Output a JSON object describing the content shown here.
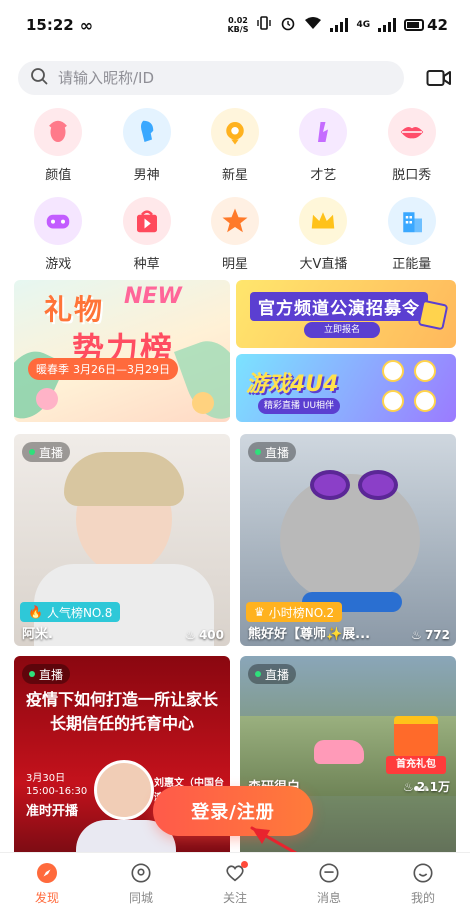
{
  "status_bar": {
    "time": "15:22",
    "net_speed_value": "0.02",
    "net_speed_unit": "KB/S",
    "network_label": "4G",
    "battery": "42"
  },
  "search": {
    "placeholder": "请输入昵称/ID"
  },
  "categories": [
    {
      "label": "颜值",
      "icon": "face-icon",
      "color": "#ff7a8a",
      "bg": "#ffe9ec"
    },
    {
      "label": "男神",
      "icon": "male-profile-icon",
      "color": "#3aa8ff",
      "bg": "#e4f3ff"
    },
    {
      "label": "新星",
      "icon": "new-star-icon",
      "color": "#ffb21f",
      "bg": "#fff5dc"
    },
    {
      "label": "才艺",
      "icon": "talent-icon",
      "color": "#c56cff",
      "bg": "#f6e9ff"
    },
    {
      "label": "脱口秀",
      "icon": "lips-icon",
      "color": "#ff4d6a",
      "bg": "#ffe9ec"
    },
    {
      "label": "游戏",
      "icon": "gamepad-icon",
      "color": "#c25cff",
      "bg": "#f5e6ff"
    },
    {
      "label": "种草",
      "icon": "play-bag-icon",
      "color": "#ff4a5c",
      "bg": "#ffe8ea"
    },
    {
      "label": "明星",
      "icon": "star-icon",
      "color": "#ff7a2a",
      "bg": "#fff0e3"
    },
    {
      "label": "大V直播",
      "icon": "crown-icon",
      "color": "#ffc21a",
      "bg": "#fff7d9"
    },
    {
      "label": "正能量",
      "icon": "building-icon",
      "color": "#3aa8ff",
      "bg": "#e4f3ff"
    }
  ],
  "banners": {
    "left": {
      "title": "礼物",
      "title_new": "NEW",
      "subtitle": "势力榜",
      "season": "暖春季",
      "date_range": "3月26日—3月29日"
    },
    "right_top": {
      "title": "官方频道公演招募令",
      "button": "立即报名"
    },
    "right_bottom": {
      "title": "游戏4U4",
      "subtitle": "精彩直播 UU相伴"
    }
  },
  "live_cards": [
    {
      "live_label": "直播",
      "rank_label": "人气榜NO.8",
      "rank_color": "#2ec8d8",
      "name": "阿米.",
      "count": "400"
    },
    {
      "live_label": "直播",
      "rank_label": "小时榜NO.2",
      "rank_color": "#ffb21f",
      "name": "熊好好【尊师✨展...",
      "count": "772"
    },
    {
      "live_label": "直播",
      "poster_title_1": "疫情下如何打造一所让家长",
      "poster_title_2": "长期信任的托育中心",
      "poster_date_1": "3月30日",
      "poster_date_2": "15:00-16:30",
      "poster_open": "准时开播",
      "poster_host": "刘惠文（中国台湾）"
    },
    {
      "live_label": "直播",
      "name": "森研很白",
      "count": "2.1万",
      "gift_label": "首充礼包"
    }
  ],
  "login_button": "登录/注册",
  "tabs": [
    {
      "label": "发现",
      "icon": "compass-icon",
      "active": true
    },
    {
      "label": "同城",
      "icon": "location-icon",
      "active": false
    },
    {
      "label": "关注",
      "icon": "heart-icon",
      "active": false
    },
    {
      "label": "消息",
      "icon": "message-icon",
      "active": false
    },
    {
      "label": "我的",
      "icon": "profile-icon",
      "active": false
    }
  ],
  "colors": {
    "accent": "#ff6a3c",
    "login_gradient_start": "#ff5a4a",
    "login_gradient_end": "#ff7b3a",
    "annotation_arrow": "#e8232e"
  }
}
